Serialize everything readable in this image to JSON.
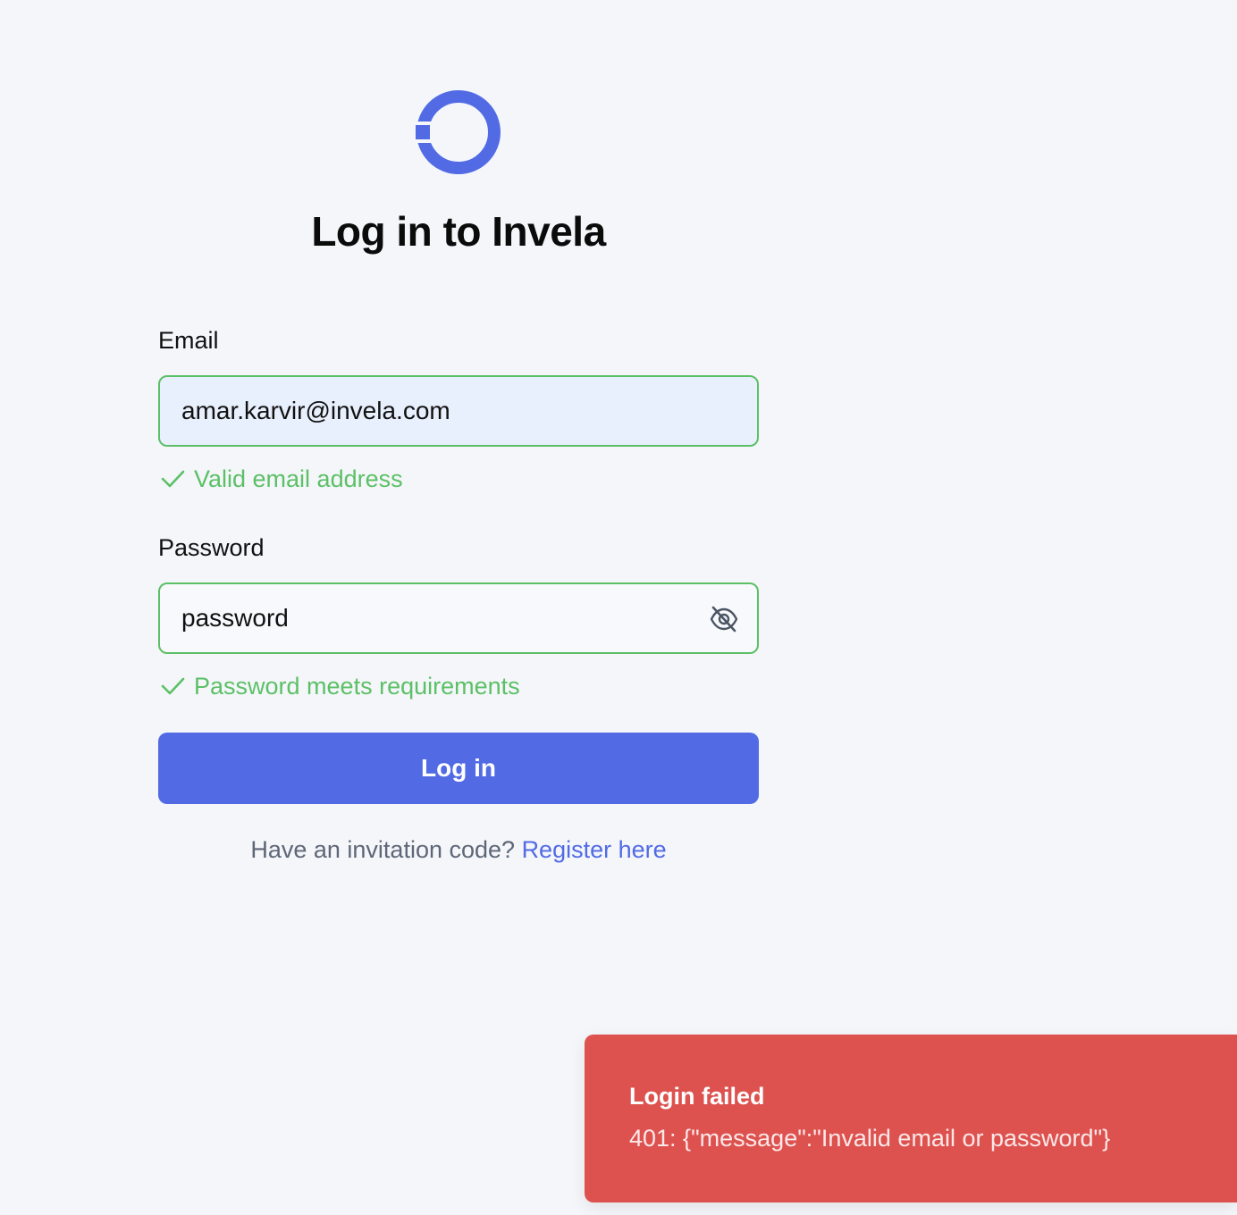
{
  "brand": {
    "logo_icon": "invela-ring-logo-icon",
    "accent_color": "#526be5"
  },
  "heading": {
    "title": "Log in to Invela"
  },
  "email": {
    "label": "Email",
    "value": "amar.karvir@invela.com",
    "validation": "Valid email address",
    "validation_icon": "check-icon"
  },
  "password": {
    "label": "Password",
    "value": "password",
    "toggle_icon": "eye-off-icon",
    "validation": "Password meets requirements",
    "validation_icon": "check-icon"
  },
  "actions": {
    "login_label": "Log in"
  },
  "register": {
    "prompt": "Have an invitation code?",
    "link_label": "Register here"
  },
  "toast": {
    "title": "Login failed",
    "description": "401: {\"message\":\"Invalid email or password\"}",
    "color": "#dd524f"
  },
  "colors": {
    "success": "#5cc066",
    "background": "#f4f6fa"
  }
}
